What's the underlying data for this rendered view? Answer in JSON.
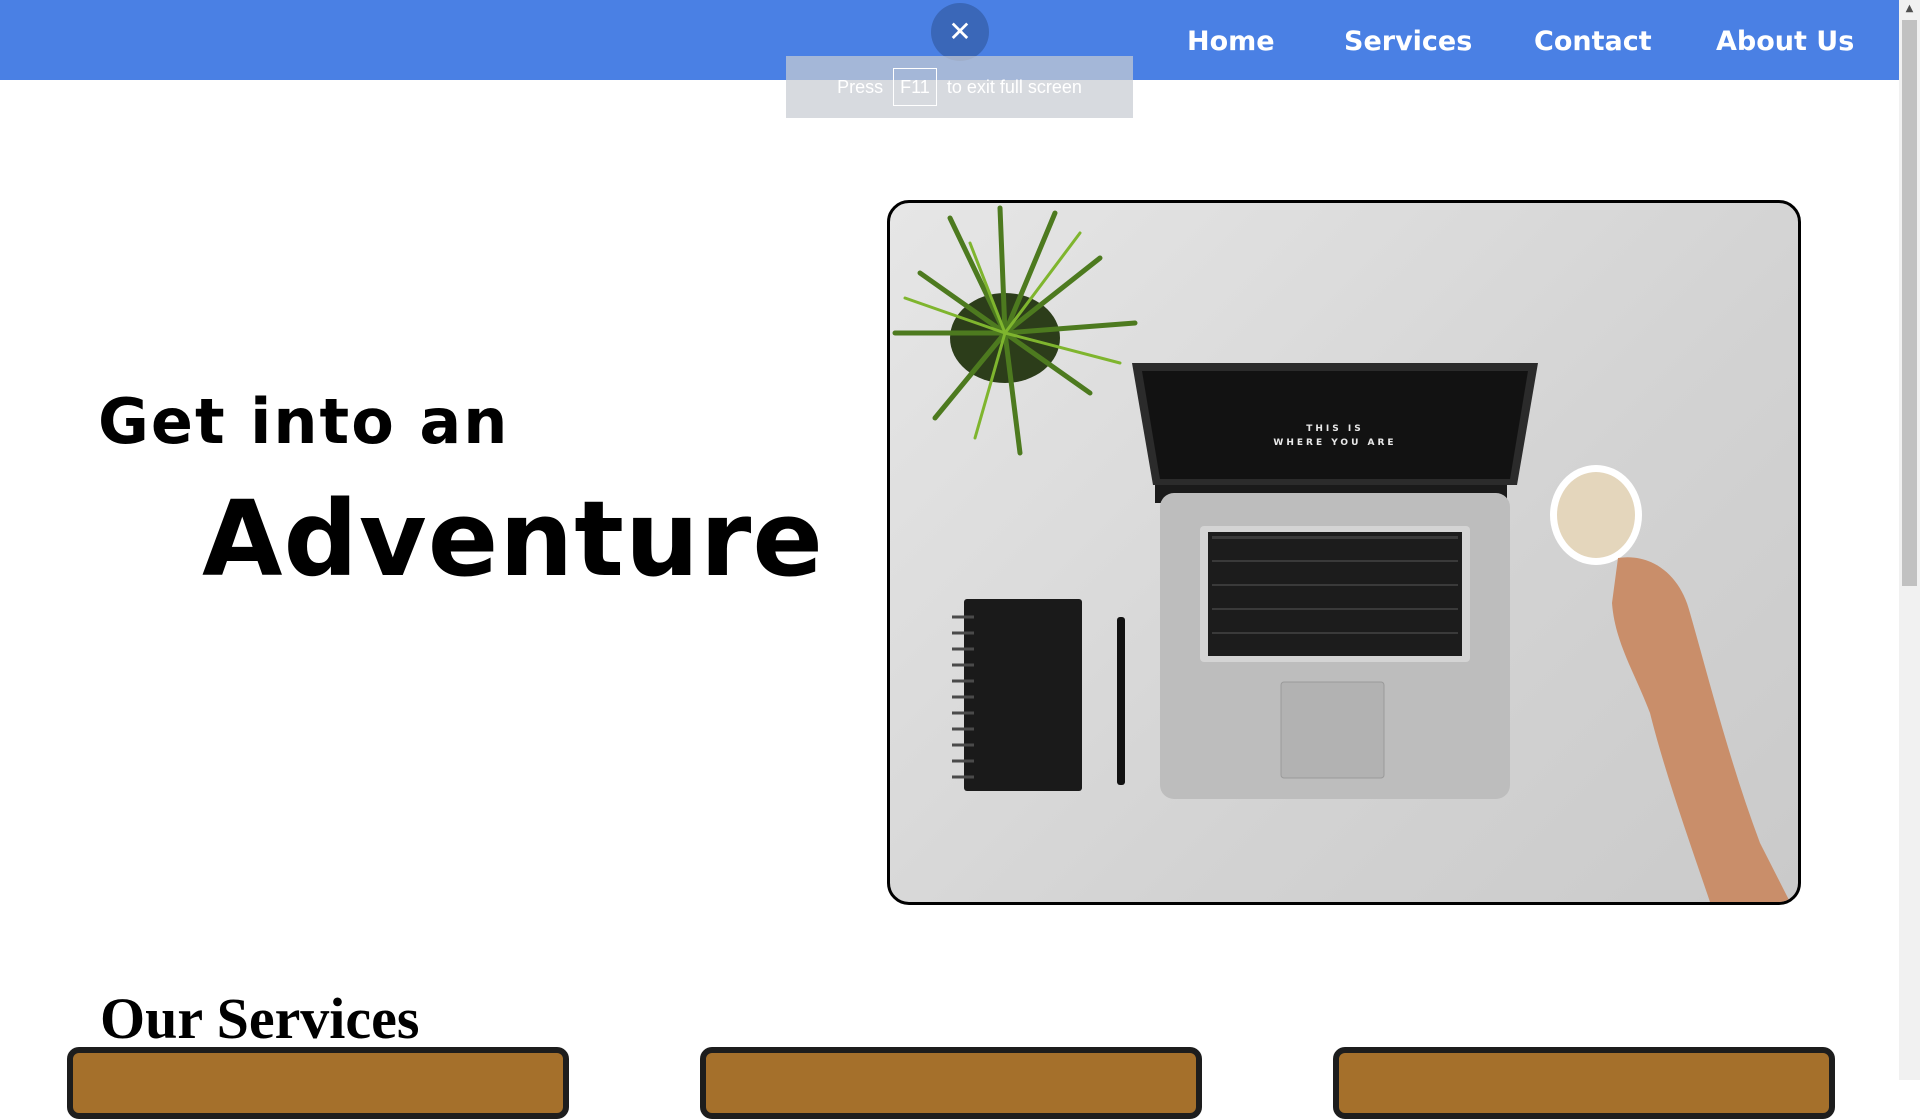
{
  "nav": {
    "links": [
      "Home",
      "Services",
      "Contact",
      "About Us"
    ],
    "bg_color": "#4a80e4"
  },
  "fullscreen_notice": {
    "close_icon": "close-icon",
    "text_before": "Press",
    "key": "F11",
    "text_after": "to exit full screen"
  },
  "hero": {
    "line1": "Get into an",
    "line2": "Adventure",
    "image": {
      "screen_line1": "THIS IS",
      "screen_line2": "WHERE YOU ARE"
    }
  },
  "services": {
    "heading": "Our Services",
    "card_color": "#a5702b"
  }
}
